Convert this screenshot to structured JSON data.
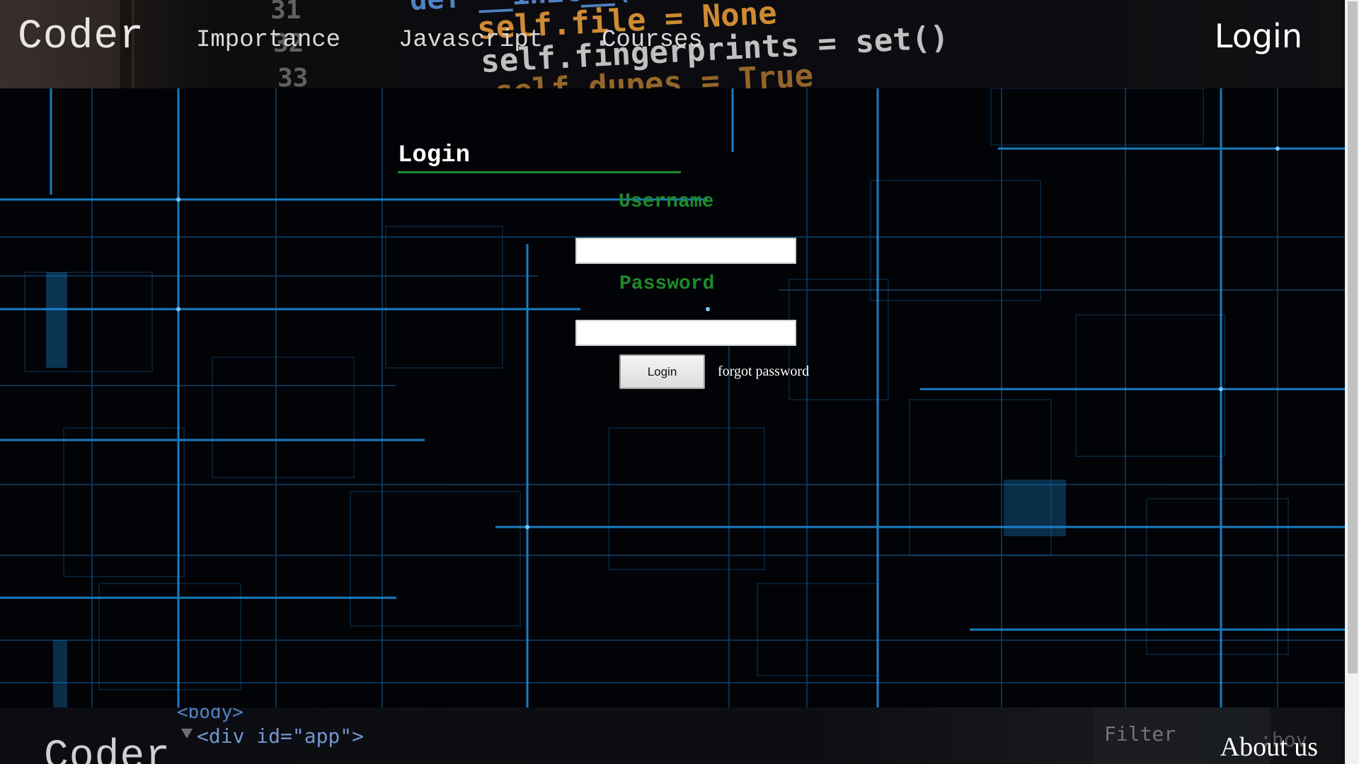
{
  "header": {
    "brand": "Coder",
    "nav": {
      "importance": "Importance",
      "javascript": "Javascript",
      "courses": "Courses"
    },
    "login_link": "Login",
    "background_code": {
      "line_numbers": [
        "31",
        "32",
        "33"
      ],
      "line1": "def __init__(self, path=None",
      "line2": "self.file = None",
      "line3": "self.fingerprints = set()",
      "line4": "self.dupes = True"
    }
  },
  "login_form": {
    "title": "Login",
    "username_label": "Username",
    "password_label": "Password",
    "username_value": "",
    "password_value": "",
    "submit_label": "Login",
    "forgot_label": "forgot password"
  },
  "footer": {
    "brand": "Coder",
    "about_link": "About us",
    "background_code": {
      "line1": "<body>",
      "line2": "<div id=\"app\">",
      "filter_text": "Filter",
      "hov_text": ":hov"
    }
  },
  "colors": {
    "accent_green": "#1f8a2a",
    "circuit_blue": "#1e90e0",
    "header_text": "#d9d9d9",
    "background": "#020307"
  }
}
